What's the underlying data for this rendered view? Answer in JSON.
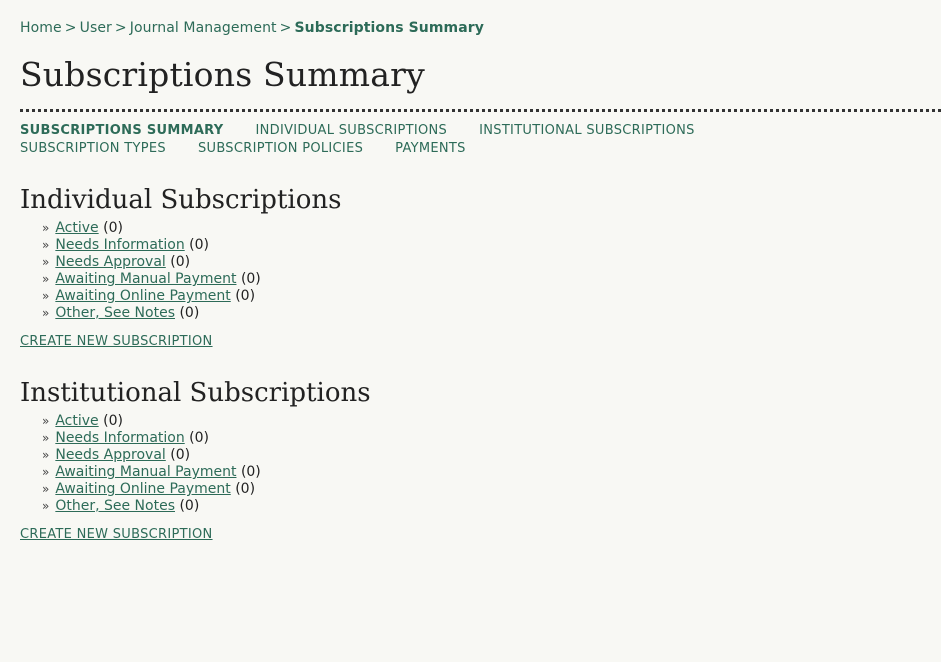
{
  "breadcrumb": {
    "home": "Home",
    "user": "User",
    "journal_management": "Journal Management",
    "current": "Subscriptions Summary",
    "separator": ">"
  },
  "page_title": "Subscriptions Summary",
  "tabs": [
    {
      "label": "Subscriptions Summary",
      "active": true
    },
    {
      "label": "Individual Subscriptions",
      "active": false
    },
    {
      "label": "Institutional Subscriptions",
      "active": false
    },
    {
      "label": "Subscription Types",
      "active": false
    },
    {
      "label": "Subscription Policies",
      "active": false
    },
    {
      "label": "Payments",
      "active": false
    }
  ],
  "individual": {
    "title": "Individual Subscriptions",
    "items": [
      {
        "label": "Active",
        "count": "(0)"
      },
      {
        "label": "Needs Information",
        "count": "(0)"
      },
      {
        "label": "Needs Approval",
        "count": "(0)"
      },
      {
        "label": "Awaiting Manual Payment",
        "count": "(0)"
      },
      {
        "label": "Awaiting Online Payment",
        "count": "(0)"
      },
      {
        "label": "Other, See Notes",
        "count": "(0)"
      }
    ],
    "create_label": "Create New Subscription"
  },
  "institutional": {
    "title": "Institutional Subscriptions",
    "items": [
      {
        "label": "Active",
        "count": "(0)"
      },
      {
        "label": "Needs Information",
        "count": "(0)"
      },
      {
        "label": "Needs Approval",
        "count": "(0)"
      },
      {
        "label": "Awaiting Manual Payment",
        "count": "(0)"
      },
      {
        "label": "Awaiting Online Payment",
        "count": "(0)"
      },
      {
        "label": "Other, See Notes",
        "count": "(0)"
      }
    ],
    "create_label": "Create New Subscription"
  },
  "bullet_glyph": "»",
  "colors": {
    "link": "#2d6b58",
    "background": "#f8f8f4",
    "text": "#222222"
  }
}
